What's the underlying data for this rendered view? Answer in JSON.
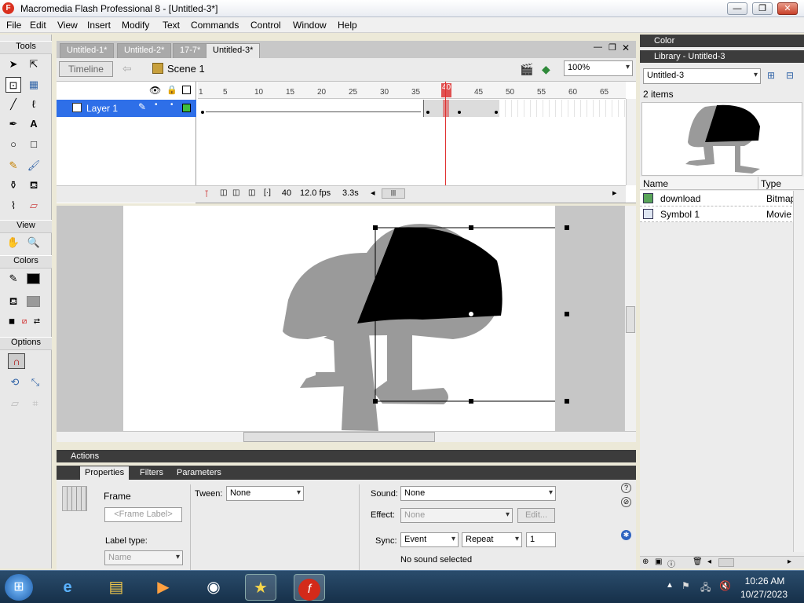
{
  "window": {
    "title": "Macromedia Flash Professional 8 - [Untitled-3*]",
    "logo": "F",
    "min": "—",
    "max": "❐",
    "close": "✕"
  },
  "menu": [
    "File",
    "Edit",
    "View",
    "Insert",
    "Modify",
    "Text",
    "Commands",
    "Control",
    "Window",
    "Help"
  ],
  "tools": {
    "title": "Tools",
    "view_title": "View",
    "colors_title": "Colors",
    "options_title": "Options"
  },
  "doc_tabs": [
    "Untitled-1*",
    "Untitled-2*",
    "17-7*",
    "Untitled-3*"
  ],
  "doc_controls": {
    "min": "—",
    "restore": "❐",
    "close": "✕"
  },
  "timeline_bar": {
    "timeline_button": "Timeline",
    "back_arrow": "⇦",
    "scene": "Scene 1",
    "zoom": "100%"
  },
  "layer": {
    "name": "Layer 1"
  },
  "ruler_ticks": [
    "1",
    "5",
    "10",
    "15",
    "20",
    "25",
    "30",
    "35",
    "40",
    "45",
    "50",
    "55",
    "60",
    "65"
  ],
  "playhead_frame": 40,
  "timeline_status": {
    "frame": "40",
    "fps": "12.0 fps",
    "time": "3.3s"
  },
  "actions_label": "Actions",
  "properties": {
    "tabs": [
      "Properties",
      "Filters",
      "Parameters"
    ],
    "frame_label": "Frame",
    "frame_label_placeholder": "<Frame Label>",
    "tween_label": "Tween:",
    "tween_value": "None",
    "sound_label": "Sound:",
    "sound_value": "None",
    "effect_label": "Effect:",
    "effect_value": "None",
    "edit_button": "Edit...",
    "label_type_label": "Label type:",
    "label_type_value": "Name",
    "sync_label": "Sync:",
    "sync_value": "Event",
    "repeat_value": "Repeat",
    "repeat_count": "1",
    "no_sound": "No sound selected"
  },
  "color_panel": {
    "title": "Color"
  },
  "library": {
    "title": "Library - Untitled-3",
    "selector": "Untitled-3",
    "count": "2 items",
    "col_name": "Name",
    "col_type": "Type",
    "items": [
      {
        "name": "download",
        "type": "Bitmap"
      },
      {
        "name": "Symbol 1",
        "type": "Movie"
      }
    ]
  },
  "tray": {
    "time": "10:26 AM",
    "date": "10/27/2023"
  },
  "taskbar_apps": [
    "start-orb",
    "internet-explorer-icon",
    "file-explorer-icon",
    "media-player-icon",
    "chrome-icon",
    "movie-maker-icon",
    "flash-icon"
  ]
}
